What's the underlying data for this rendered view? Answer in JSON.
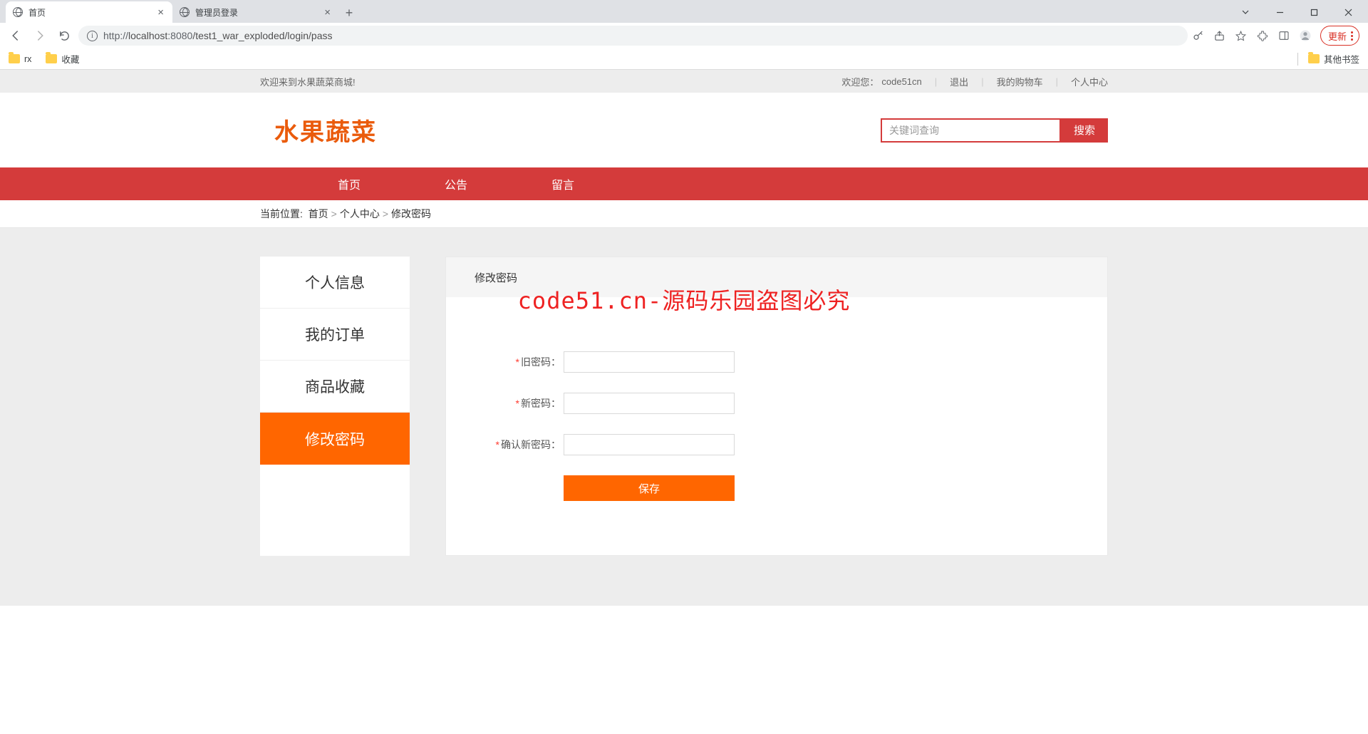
{
  "browser": {
    "tabs": [
      {
        "title": "首页",
        "active": true
      },
      {
        "title": "管理员登录",
        "active": false
      }
    ],
    "url_host": "localhost",
    "url_port": ":8080",
    "url_path": "/test1_war_exploded/login/pass",
    "url_proto": "http://",
    "update_label": "更新",
    "bookmarks": {
      "rx": "rx",
      "fav": "收藏",
      "other": "其他书签"
    }
  },
  "topbar": {
    "welcome": "欢迎来到水果蔬菜商城!",
    "welcome_user_prefix": "欢迎您：",
    "user": "code51cn",
    "logout": "退出",
    "cart": "我的购物车",
    "center": "个人中心"
  },
  "header": {
    "logo": "水果蔬菜",
    "search_placeholder": "关键词查询",
    "search_button": "搜索"
  },
  "nav": {
    "home": "首页",
    "notice": "公告",
    "msg": "留言"
  },
  "crumb": {
    "prefix": "当前位置:",
    "home": "首页",
    "center": "个人中心",
    "current": "修改密码"
  },
  "side": {
    "profile": "个人信息",
    "orders": "我的订单",
    "fav": "商品收藏",
    "pass": "修改密码"
  },
  "panel": {
    "title": "修改密码",
    "old": "旧密码：",
    "new": "新密码：",
    "confirm": "确认新密码：",
    "save": "保存"
  },
  "watermark": "code51.cn-源码乐园盗图必究"
}
